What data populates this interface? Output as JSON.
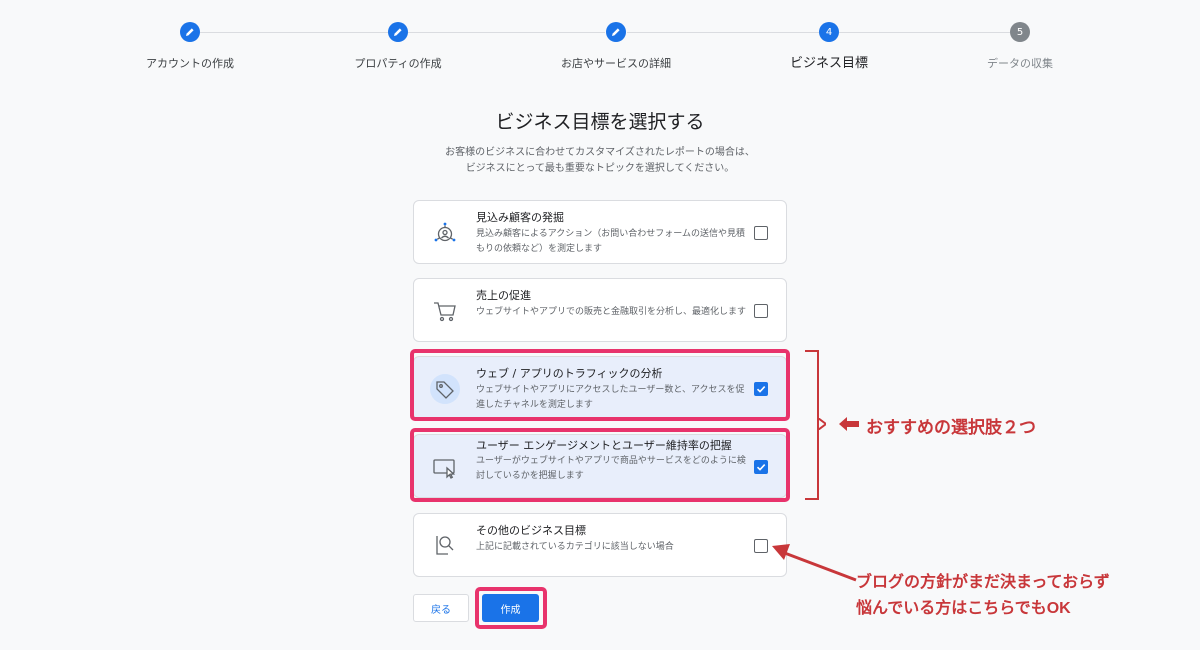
{
  "stepper": {
    "steps": [
      {
        "label": "アカウントの作成",
        "state": "done"
      },
      {
        "label": "プロパティの作成",
        "state": "done"
      },
      {
        "label": "お店やサービスの詳細",
        "state": "done"
      },
      {
        "label": "ビジネス目標",
        "state": "active",
        "number": "4"
      },
      {
        "label": "データの収集",
        "state": "pending",
        "number": "5"
      }
    ]
  },
  "page": {
    "title": "ビジネス目標を選択する",
    "description_line1": "お客様のビジネスに合わせてカスタマイズされたレポートの場合は、",
    "description_line2": "ビジネスにとって最も重要なトピックを選択してください。"
  },
  "goals": [
    {
      "title": "見込み顧客の発掘",
      "description": "見込み顧客によるアクション（お問い合わせフォームの送信や見積もりの依頼など）を測定します",
      "checked": false,
      "icon": "lead-target-icon"
    },
    {
      "title": "売上の促進",
      "description": "ウェブサイトやアプリでの販売と金融取引を分析し、最適化します",
      "checked": false,
      "icon": "shopping-cart-icon"
    },
    {
      "title": "ウェブ / アプリのトラフィックの分析",
      "description": "ウェブサイトやアプリにアクセスしたユーザー数と、アクセスを促進したチャネルを測定します",
      "checked": true,
      "icon": "tag-icon"
    },
    {
      "title": "ユーザー エンゲージメントとユーザー維持率の把握",
      "description": "ユーザーがウェブサイトやアプリで商品やサービスをどのように検討しているかを把握します",
      "checked": true,
      "icon": "screen-cursor-icon"
    },
    {
      "title": "その他のビジネス目標",
      "description": "上記に記載されているカテゴリに該当しない場合",
      "checked": false,
      "icon": "search-document-icon"
    }
  ],
  "buttons": {
    "back": "戻る",
    "create": "作成"
  },
  "annotations": {
    "recommended": "おすすめの選択肢２つ",
    "other_line1": "ブログの方針がまだ決まっておらず",
    "other_line2": "悩んでいる方はこちらでもOK"
  },
  "colors": {
    "accent": "#1a73e8",
    "highlight": "#e8336c",
    "annotation": "#c8373a"
  }
}
